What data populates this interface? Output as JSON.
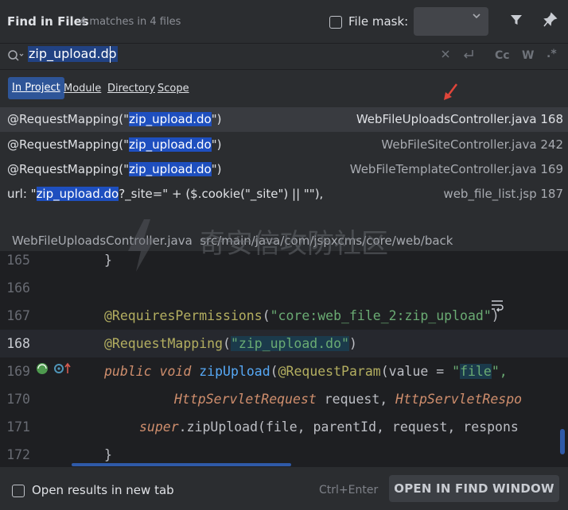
{
  "header": {
    "title": "Find in Files",
    "match_summary": "4 matches in 4 files",
    "file_mask_label": "File mask:",
    "file_mask_value": ""
  },
  "search": {
    "query": "zip_upload.do",
    "icons": [
      "search-icon",
      "clear-icon",
      "newline-icon",
      "match-case-icon",
      "whole-words-icon",
      "regex-icon"
    ],
    "case_label": "Cc",
    "word_label": "W",
    "regex_label": ".*"
  },
  "scope_tabs": [
    {
      "label": "In Project",
      "selected": true
    },
    {
      "label": "Module",
      "selected": false
    },
    {
      "label": "Directory",
      "selected": false
    },
    {
      "label": "Scope",
      "selected": false
    }
  ],
  "results": [
    {
      "prefix": "@RequestMapping(\"",
      "match": "zip_upload.do",
      "suffix": "\")",
      "file": "WebFileUploadsController.java 168",
      "selected": true
    },
    {
      "prefix": "@RequestMapping(\"",
      "match": "zip_upload.do",
      "suffix": "\")",
      "file": "WebFileSiteController.java 242",
      "selected": false
    },
    {
      "prefix": "@RequestMapping(\"",
      "match": "zip_upload.do",
      "suffix": "\")",
      "file": "WebFileTemplateController.java 169",
      "selected": false
    },
    {
      "prefix": "url: \"",
      "match": "zip_upload.do",
      "suffix": "?_site=\" + ($.cookie(\"_site\") || \"\"),",
      "file": "web_file_list.jsp 187",
      "selected": false
    }
  ],
  "preview": {
    "path": "WebFileUploadsController.java  src/main/java/com/jspxcms/core/web/back",
    "watermark": "奇安信攻防社区",
    "line_numbers": [
      "165",
      "166",
      "167",
      "168",
      "169",
      "170",
      "171",
      "172"
    ],
    "lines": {
      "l165": "}",
      "l167_ann": "@RequiresPermissions",
      "l167_open": "(",
      "l167_str": "\"core:web_file_2:zip_upload\"",
      "l167_close": ")",
      "l168_ann": "@RequestMapping",
      "l168_open": "(",
      "l168_str": "\"zip_upload.do\"",
      "l168_close": ")",
      "l169_kw1": "public",
      "l169_kw2": "void",
      "l169_fn": "zipUpload",
      "l169_p1": "(",
      "l169_ann": "@RequestParam",
      "l169_p2": "(value = ",
      "l169_q1": "\"",
      "l169_file": "file",
      "l169_q2": "\",",
      "l170_t1": "HttpServletRequest",
      "l170_v1": " request, ",
      "l170_t2": "HttpServletRespo",
      "l171_kw": "super",
      "l171_rest": ".zipUpload(file, parentId, request, respons",
      "l172": "}"
    }
  },
  "footer": {
    "new_tab_label": "Open results in new tab",
    "shortcut": "Ctrl+Enter",
    "open_button": "OPEN IN FIND WINDOW"
  },
  "colors": {
    "background": "#2b2d30",
    "editor_background": "#1e1f22",
    "match_highlight": "#1e4fbf",
    "selected_scope": "#2e5598",
    "annotation": "#b3ae60",
    "string": "#6aab73",
    "keyword": "#cf8e6d",
    "function": "#56a8f5",
    "arrow": "#e0453a"
  }
}
